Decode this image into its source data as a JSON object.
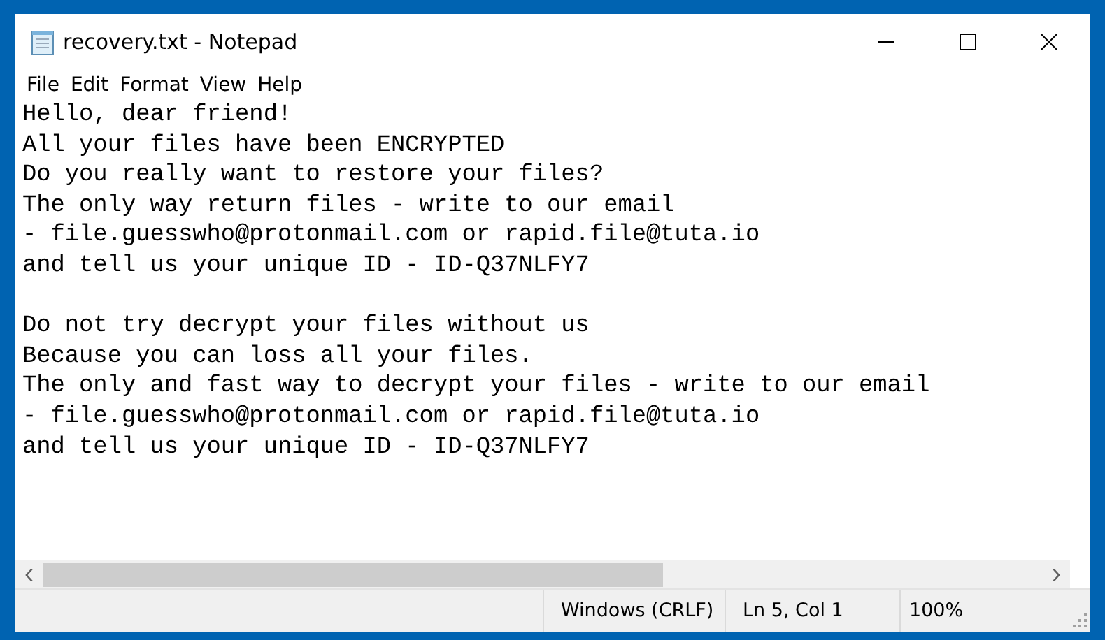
{
  "window": {
    "title": "recovery.txt - Notepad"
  },
  "menu": [
    "File",
    "Edit",
    "Format",
    "View",
    "Help"
  ],
  "document": {
    "paragraphs": [
      [
        "Hello, dear friend!",
        "All your files have been ENCRYPTED",
        "Do you really want to restore your files?",
        "The only way return files - write to our email",
        "- file.guesswho@protonmail.com or rapid.file@tuta.io",
        "and tell us your unique ID - ID-Q37NLFY7"
      ],
      [
        "Do not try decrypt your files without us",
        "Because you can loss all your files.",
        "The only and fast way to decrypt your files - write to our email",
        "- file.guesswho@protonmail.com or rapid.file@tuta.io",
        "and tell us your unique ID - ID-Q37NLFY7"
      ]
    ]
  },
  "status_bar": [
    "Windows (CRLF)",
    "Ln 5, Col 1",
    "100%"
  ]
}
